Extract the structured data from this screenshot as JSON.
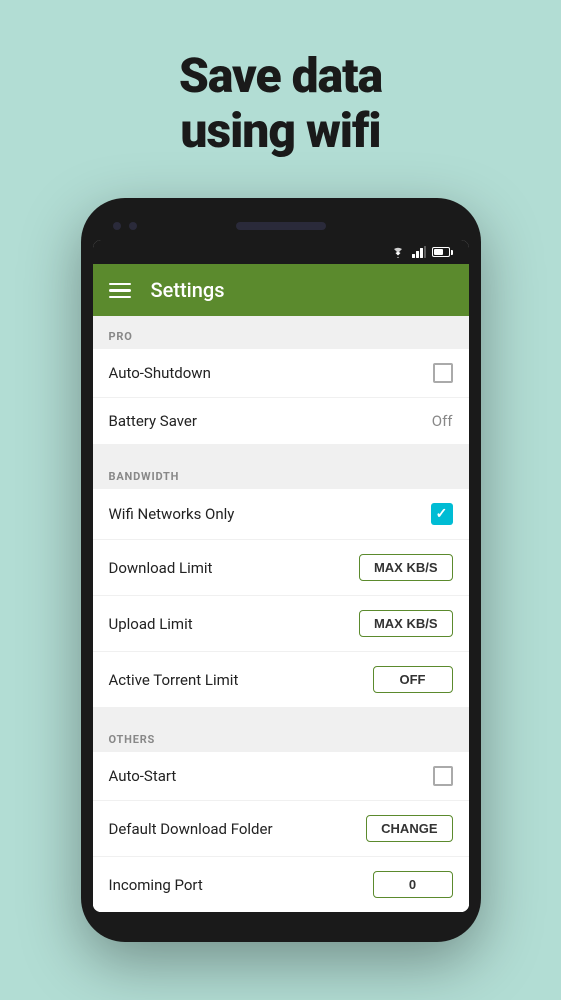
{
  "hero": {
    "line1": "Save data",
    "line2": "using wifi"
  },
  "status_bar": {
    "wifi": "wifi",
    "signal": "signal",
    "battery": "battery"
  },
  "app_bar": {
    "title": "Settings",
    "menu_icon": "hamburger"
  },
  "sections": [
    {
      "header": "PRO",
      "rows": [
        {
          "label": "Auto-Shutdown",
          "control": "checkbox-empty"
        },
        {
          "label": "Battery Saver",
          "control": "text",
          "value": "Off"
        }
      ]
    },
    {
      "header": "BANDWIDTH",
      "rows": [
        {
          "label": "Wifi Networks Only",
          "control": "checkbox-checked"
        },
        {
          "label": "Download Limit",
          "control": "button",
          "value": "MAX KB/S"
        },
        {
          "label": "Upload Limit",
          "control": "button",
          "value": "MAX KB/S"
        },
        {
          "label": "Active Torrent Limit",
          "control": "button",
          "value": "OFF"
        }
      ]
    },
    {
      "header": "OTHERS",
      "rows": [
        {
          "label": "Auto-Start",
          "control": "checkbox-empty"
        },
        {
          "label": "Default Download Folder",
          "control": "button",
          "value": "CHANGE"
        },
        {
          "label": "Incoming Port",
          "control": "button",
          "value": "0"
        }
      ]
    }
  ]
}
